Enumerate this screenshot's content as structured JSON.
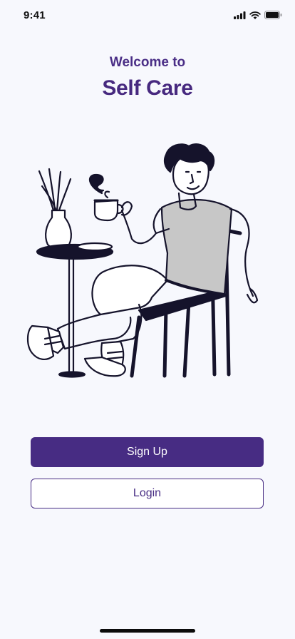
{
  "status_bar": {
    "time": "9:41",
    "icons": [
      "signal-icon",
      "wifi-icon",
      "battery-icon"
    ]
  },
  "header": {
    "welcome": "Welcome to",
    "title": "Self Care"
  },
  "illustration": {
    "subject": "person-relaxing-with-coffee"
  },
  "actions": {
    "signup_label": "Sign Up",
    "login_label": "Login"
  },
  "colors": {
    "brand": "#472c83",
    "background": "#f7f8fd",
    "shirt": "#c7c7c7",
    "ink": "#15132b"
  }
}
